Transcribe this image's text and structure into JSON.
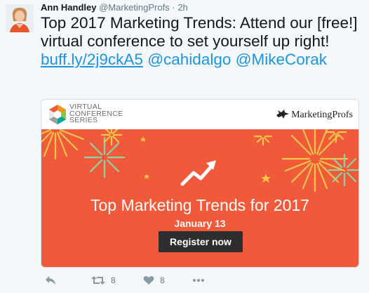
{
  "tweet": {
    "author_name": "Ann Handley",
    "author_handle": "@MarketingProfs",
    "separator": "·",
    "time": "2h",
    "text_before": "Top 2017 Marketing Trends: Attend our [free!] virtual conference to set yourself up right!",
    "link": "buff.ly/2j9ckA5",
    "mention_1": "@cahidalgo",
    "mention_2": "@MikeCorak"
  },
  "card": {
    "series_line1": "Virtual",
    "series_line2": "Conference",
    "series_line3": "Series",
    "brand": "MarketingProfs",
    "banner_title": "Top Marketing Trends for 2017",
    "banner_date": "January 13",
    "cta_label": "Register now",
    "banner_color": "#f05a3a"
  },
  "actions": {
    "retweet_count": "8",
    "like_count": "8"
  },
  "colors": {
    "link": "#1b95e0",
    "muted": "#657786",
    "background": "#f5f8fa"
  }
}
